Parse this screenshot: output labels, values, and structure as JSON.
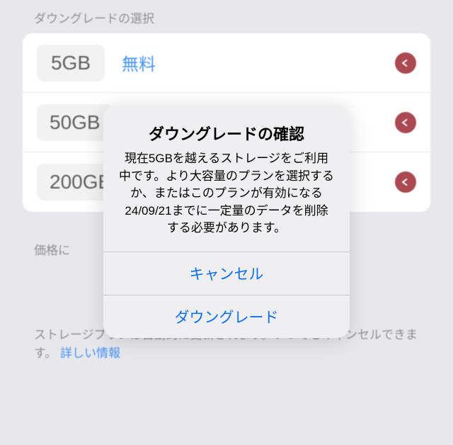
{
  "section_header": "ダウングレードの選択",
  "plans": [
    {
      "size": "5GB",
      "label": "無料"
    },
    {
      "size": "50GB",
      "label": ""
    },
    {
      "size": "200GB",
      "label": ""
    }
  ],
  "price_note": "価格に",
  "auto_renew_text": "ストレージプランは自動的に更新されます。いつでもキャンセルできます。",
  "more_info_link": "詳しい情報",
  "alert": {
    "title": "ダウングレードの確認",
    "message": "現在5GBを越えるストレージをご利用中です。より大容量のプランを選択するか、またはこのプランが有効になる24/09/21までに一定量のデータを削除する必要があります。",
    "cancel": "キャンセル",
    "confirm": "ダウングレード"
  }
}
